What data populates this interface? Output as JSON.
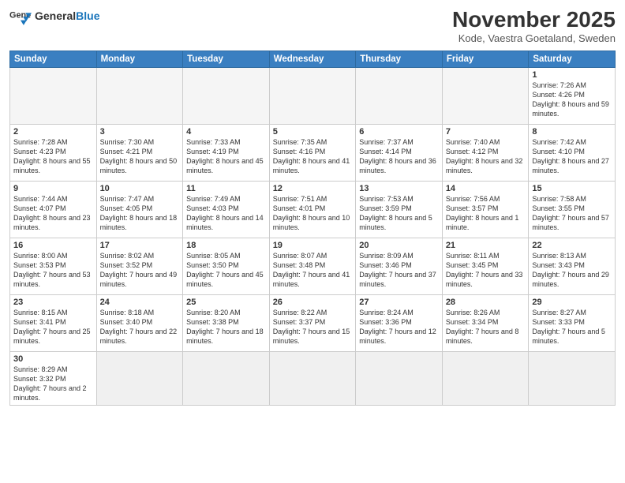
{
  "logo": {
    "general": "General",
    "blue": "Blue"
  },
  "header": {
    "month": "November 2025",
    "location": "Kode, Vaestra Goetaland, Sweden"
  },
  "weekdays": [
    "Sunday",
    "Monday",
    "Tuesday",
    "Wednesday",
    "Thursday",
    "Friday",
    "Saturday"
  ],
  "week1": [
    {
      "day": "",
      "info": ""
    },
    {
      "day": "",
      "info": ""
    },
    {
      "day": "",
      "info": ""
    },
    {
      "day": "",
      "info": ""
    },
    {
      "day": "",
      "info": ""
    },
    {
      "day": "",
      "info": ""
    },
    {
      "day": "1",
      "info": "Sunrise: 7:26 AM\nSunset: 4:26 PM\nDaylight: 8 hours\nand 59 minutes."
    }
  ],
  "week2": [
    {
      "day": "2",
      "info": "Sunrise: 7:28 AM\nSunset: 4:23 PM\nDaylight: 8 hours\nand 55 minutes."
    },
    {
      "day": "3",
      "info": "Sunrise: 7:30 AM\nSunset: 4:21 PM\nDaylight: 8 hours\nand 50 minutes."
    },
    {
      "day": "4",
      "info": "Sunrise: 7:33 AM\nSunset: 4:19 PM\nDaylight: 8 hours\nand 45 minutes."
    },
    {
      "day": "5",
      "info": "Sunrise: 7:35 AM\nSunset: 4:16 PM\nDaylight: 8 hours\nand 41 minutes."
    },
    {
      "day": "6",
      "info": "Sunrise: 7:37 AM\nSunset: 4:14 PM\nDaylight: 8 hours\nand 36 minutes."
    },
    {
      "day": "7",
      "info": "Sunrise: 7:40 AM\nSunset: 4:12 PM\nDaylight: 8 hours\nand 32 minutes."
    },
    {
      "day": "8",
      "info": "Sunrise: 7:42 AM\nSunset: 4:10 PM\nDaylight: 8 hours\nand 27 minutes."
    }
  ],
  "week3": [
    {
      "day": "9",
      "info": "Sunrise: 7:44 AM\nSunset: 4:07 PM\nDaylight: 8 hours\nand 23 minutes."
    },
    {
      "day": "10",
      "info": "Sunrise: 7:47 AM\nSunset: 4:05 PM\nDaylight: 8 hours\nand 18 minutes."
    },
    {
      "day": "11",
      "info": "Sunrise: 7:49 AM\nSunset: 4:03 PM\nDaylight: 8 hours\nand 14 minutes."
    },
    {
      "day": "12",
      "info": "Sunrise: 7:51 AM\nSunset: 4:01 PM\nDaylight: 8 hours\nand 10 minutes."
    },
    {
      "day": "13",
      "info": "Sunrise: 7:53 AM\nSunset: 3:59 PM\nDaylight: 8 hours\nand 5 minutes."
    },
    {
      "day": "14",
      "info": "Sunrise: 7:56 AM\nSunset: 3:57 PM\nDaylight: 8 hours\nand 1 minute."
    },
    {
      "day": "15",
      "info": "Sunrise: 7:58 AM\nSunset: 3:55 PM\nDaylight: 7 hours\nand 57 minutes."
    }
  ],
  "week4": [
    {
      "day": "16",
      "info": "Sunrise: 8:00 AM\nSunset: 3:53 PM\nDaylight: 7 hours\nand 53 minutes."
    },
    {
      "day": "17",
      "info": "Sunrise: 8:02 AM\nSunset: 3:52 PM\nDaylight: 7 hours\nand 49 minutes."
    },
    {
      "day": "18",
      "info": "Sunrise: 8:05 AM\nSunset: 3:50 PM\nDaylight: 7 hours\nand 45 minutes."
    },
    {
      "day": "19",
      "info": "Sunrise: 8:07 AM\nSunset: 3:48 PM\nDaylight: 7 hours\nand 41 minutes."
    },
    {
      "day": "20",
      "info": "Sunrise: 8:09 AM\nSunset: 3:46 PM\nDaylight: 7 hours\nand 37 minutes."
    },
    {
      "day": "21",
      "info": "Sunrise: 8:11 AM\nSunset: 3:45 PM\nDaylight: 7 hours\nand 33 minutes."
    },
    {
      "day": "22",
      "info": "Sunrise: 8:13 AM\nSunset: 3:43 PM\nDaylight: 7 hours\nand 29 minutes."
    }
  ],
  "week5": [
    {
      "day": "23",
      "info": "Sunrise: 8:15 AM\nSunset: 3:41 PM\nDaylight: 7 hours\nand 25 minutes."
    },
    {
      "day": "24",
      "info": "Sunrise: 8:18 AM\nSunset: 3:40 PM\nDaylight: 7 hours\nand 22 minutes."
    },
    {
      "day": "25",
      "info": "Sunrise: 8:20 AM\nSunset: 3:38 PM\nDaylight: 7 hours\nand 18 minutes."
    },
    {
      "day": "26",
      "info": "Sunrise: 8:22 AM\nSunset: 3:37 PM\nDaylight: 7 hours\nand 15 minutes."
    },
    {
      "day": "27",
      "info": "Sunrise: 8:24 AM\nSunset: 3:36 PM\nDaylight: 7 hours\nand 12 minutes."
    },
    {
      "day": "28",
      "info": "Sunrise: 8:26 AM\nSunset: 3:34 PM\nDaylight: 7 hours\nand 8 minutes."
    },
    {
      "day": "29",
      "info": "Sunrise: 8:27 AM\nSunset: 3:33 PM\nDaylight: 7 hours\nand 5 minutes."
    }
  ],
  "week6": [
    {
      "day": "30",
      "info": "Sunrise: 8:29 AM\nSunset: 3:32 PM\nDaylight: 7 hours\nand 2 minutes."
    },
    {
      "day": "",
      "info": ""
    },
    {
      "day": "",
      "info": ""
    },
    {
      "day": "",
      "info": ""
    },
    {
      "day": "",
      "info": ""
    },
    {
      "day": "",
      "info": ""
    },
    {
      "day": "",
      "info": ""
    }
  ]
}
